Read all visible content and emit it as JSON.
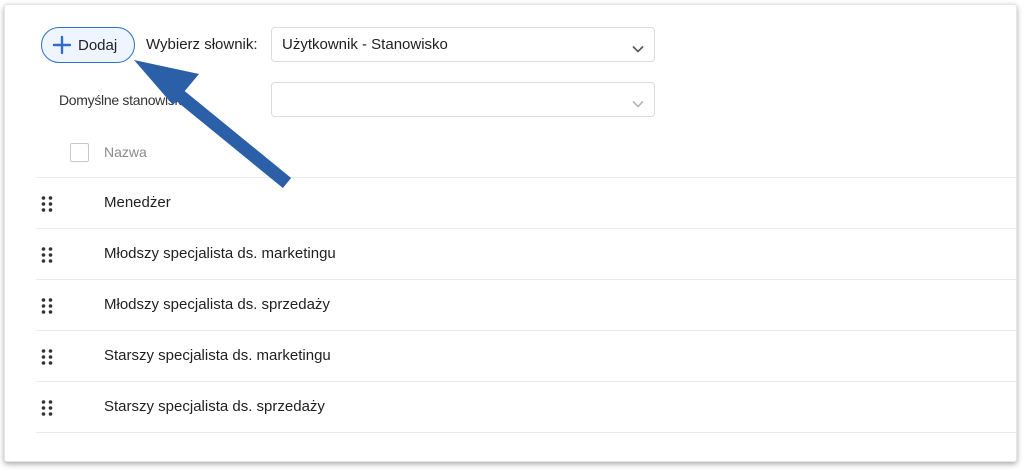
{
  "toolbar": {
    "add_button": {
      "label": "Dodaj",
      "icon": "plus-icon"
    },
    "dictionary_label": "Wybierz słownik:",
    "dictionary_value": "Użytkownik - Stanowisko",
    "default_label": "Domyślne stanowisko:",
    "default_value": ""
  },
  "table": {
    "header": {
      "label": "Nazwa"
    },
    "rows": [
      {
        "label": "Menedżer"
      },
      {
        "label": "Młodszy specjalista ds. marketingu"
      },
      {
        "label": "Młodszy specjalista ds. sprzedaży"
      },
      {
        "label": "Starszy specjalista ds. marketingu"
      },
      {
        "label": "Starszy specjalista ds. sprzedaży"
      }
    ]
  },
  "colors": {
    "accent": "#2f6fc7",
    "annotation_arrow": "#2b5fa8"
  }
}
